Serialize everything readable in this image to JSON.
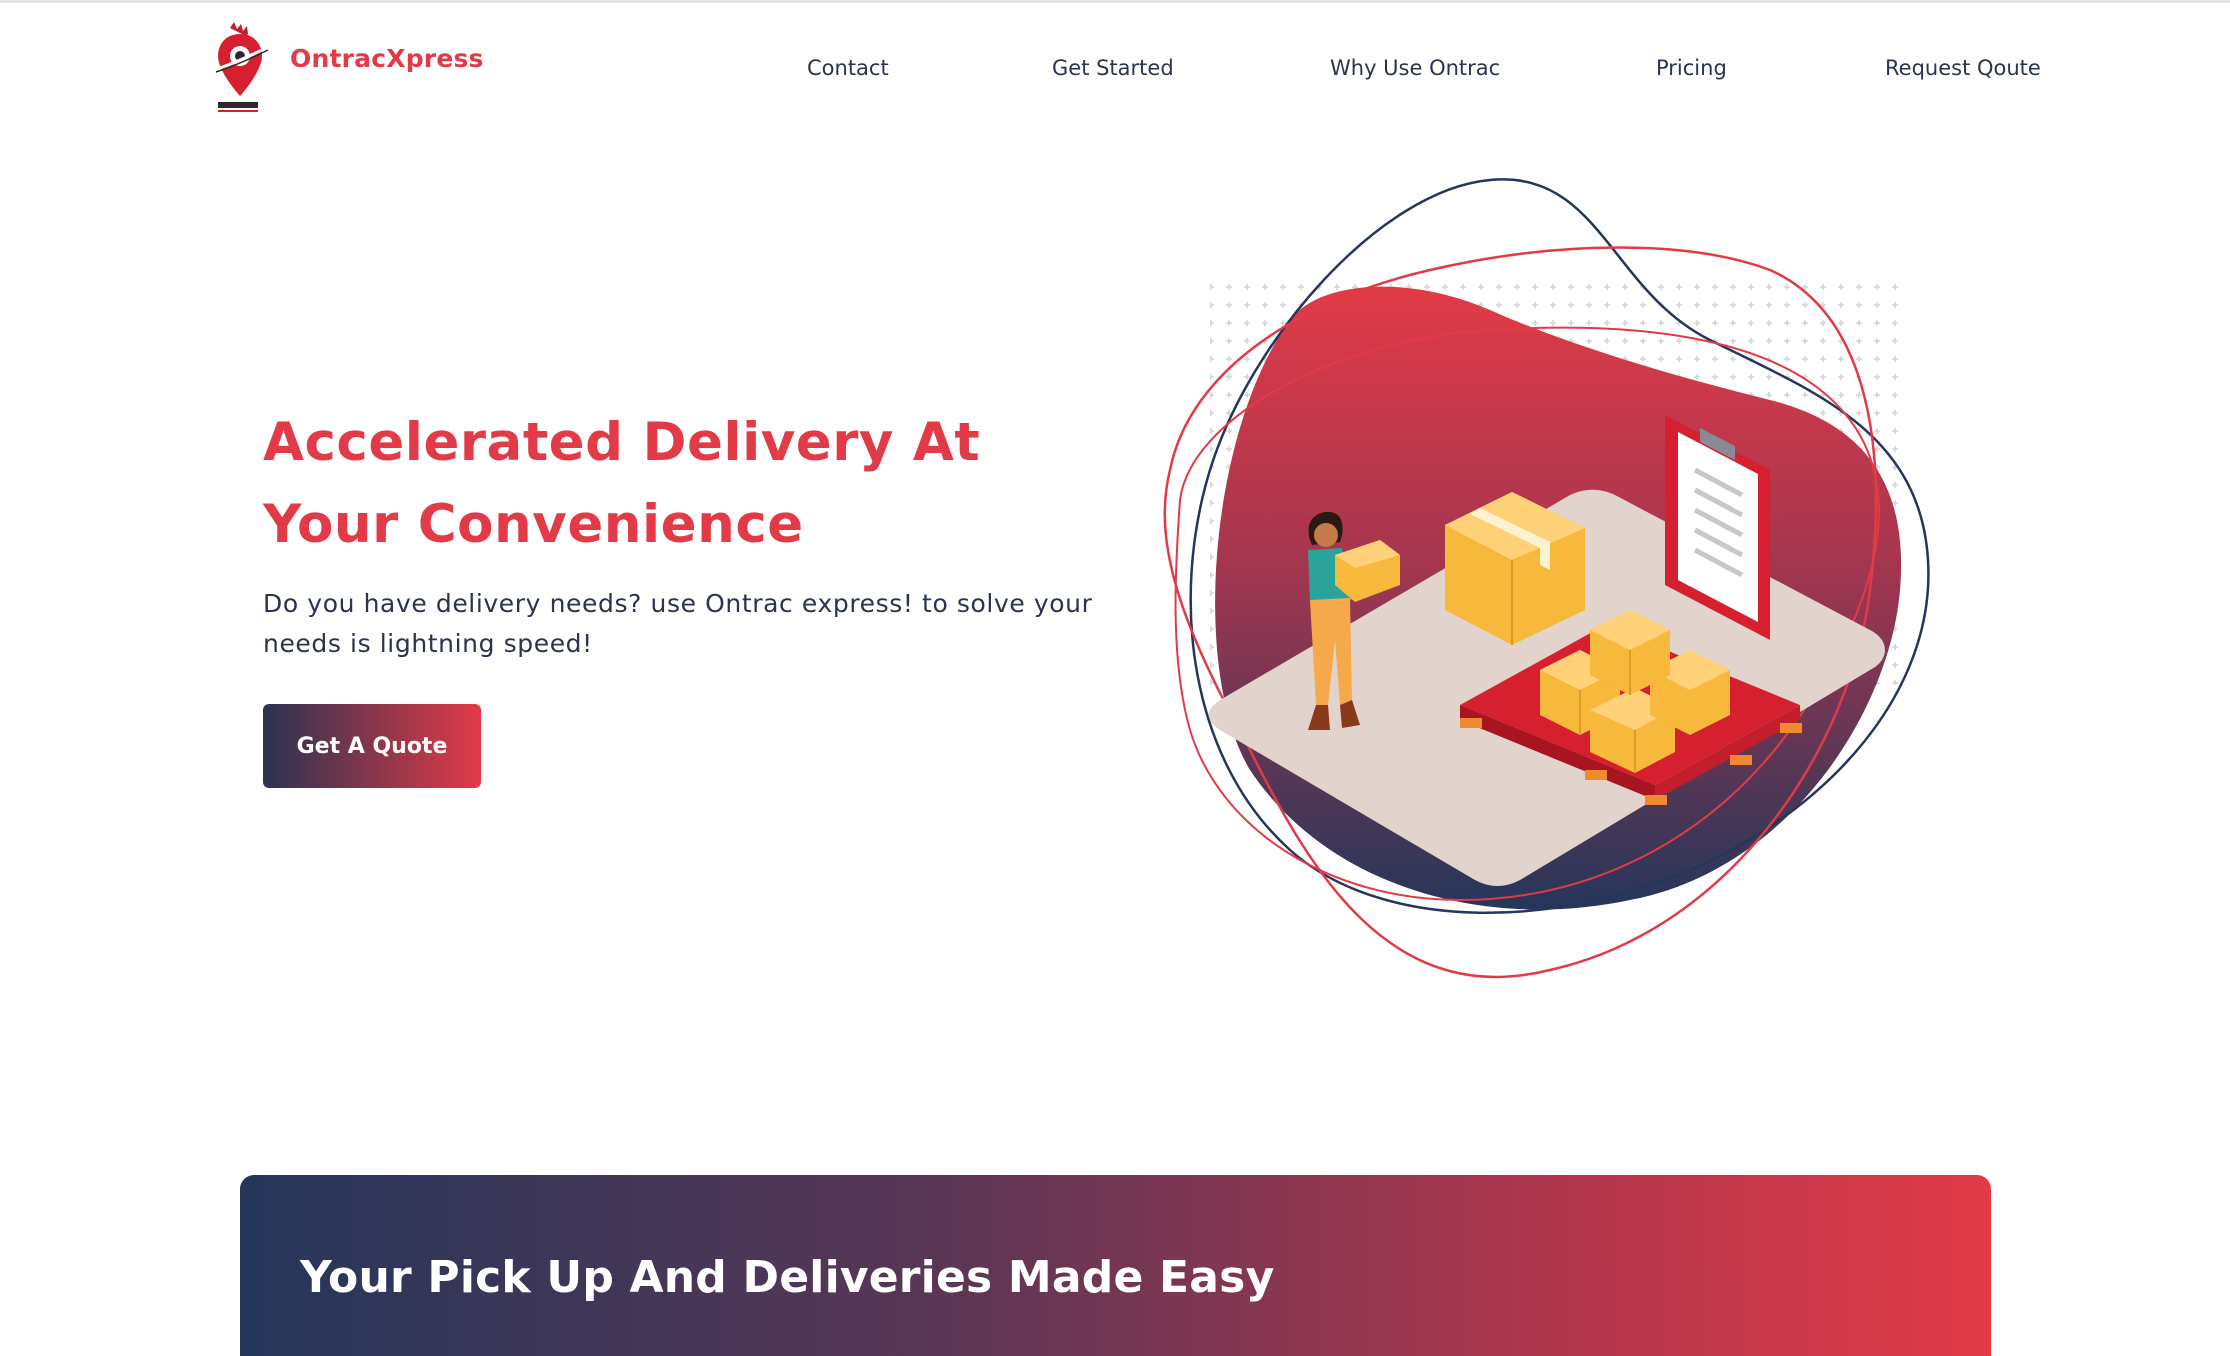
{
  "brand": {
    "name": "OntracXpress",
    "logo_icon": "location-pin-logo",
    "color": "#e23a47"
  },
  "nav": {
    "items": [
      {
        "label": "Contact"
      },
      {
        "label": "Get Started"
      },
      {
        "label": "Why Use Ontrac"
      },
      {
        "label": "Pricing"
      },
      {
        "label": "Request Qoute"
      }
    ]
  },
  "hero": {
    "title_line1": "Accelerated Delivery At",
    "title_line2": "Your Convenience",
    "subtitle_line1": "Do you have delivery needs? use Ontrac express! to solve your",
    "subtitle_line2": "needs is lightning speed!",
    "cta_label": "Get A Quote",
    "illustration": "delivery-warehouse-illustration"
  },
  "banner": {
    "title": "Your Pick Up And Deliveries Made Easy"
  },
  "colors": {
    "accent": "#e23a47",
    "navy": "#2a3350",
    "blob_top": "#e23a47",
    "blob_bottom": "#25365a"
  }
}
